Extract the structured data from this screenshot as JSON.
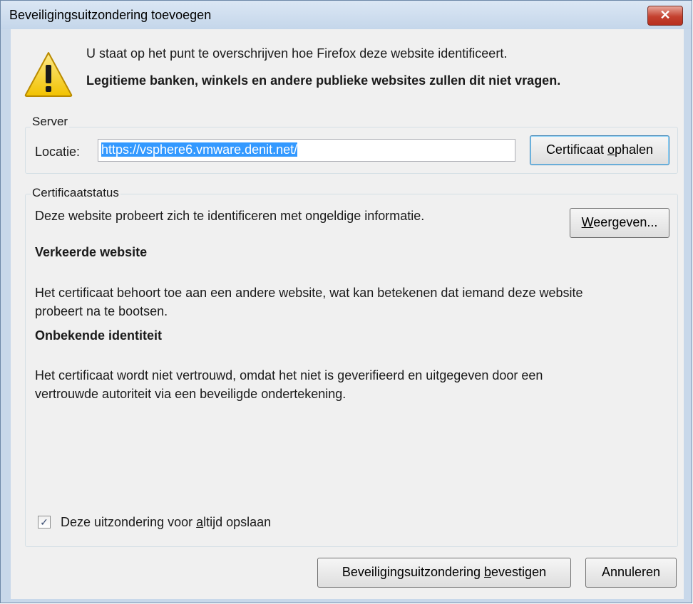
{
  "dialog": {
    "title": "Beveiligingsuitzondering toevoegen",
    "close_label": "✕",
    "message_line1": "U staat op het punt te overschrijven hoe Firefox deze website identificeert.",
    "message_line2": "Legitieme banken, winkels en andere publieke websites zullen dit niet vragen."
  },
  "server": {
    "group_label": "Server",
    "location_label": "Locatie:",
    "location_value": "https://vsphere6.vmware.denit.net/",
    "fetch_button": {
      "before": "Certificaat ",
      "accel": "o",
      "after": "phalen"
    }
  },
  "cert_status": {
    "group_label": "Certificaatstatus",
    "intro": "Deze website probeert zich te identificeren met ongeldige informatie.",
    "view_button": {
      "accel": "W",
      "after": "eergeven..."
    },
    "wrong_site_heading": "Verkeerde website",
    "wrong_site_line1": "Het certificaat behoort toe aan een andere website, wat kan betekenen dat iemand deze website",
    "wrong_site_line2": "probeert na te bootsen.",
    "unknown_heading": "Onbekende identiteit",
    "unknown_line1": "Het certificaat wordt niet vertrouwd, omdat het niet is geverifieerd en uitgegeven door een",
    "unknown_line2": "vertrouwde autoriteit via een beveiligde ondertekening."
  },
  "permanent": {
    "checked": true,
    "label_before": "Deze uitzondering voor ",
    "label_accel": "a",
    "label_after": "ltijd opslaan"
  },
  "buttons": {
    "confirm": {
      "before": "Beveiligingsuitzondering ",
      "accel": "b",
      "after": "evestigen"
    },
    "cancel": "Annuleren"
  },
  "colors": {
    "selection": "#3399ff",
    "title_bar": "#c4d6ea",
    "close_button": "#c4412f",
    "warning_icon": "#f2c200"
  }
}
